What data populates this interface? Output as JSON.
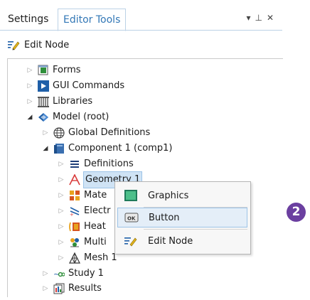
{
  "tabs": {
    "settings": "Settings",
    "editor_tools": "Editor Tools"
  },
  "window_controls": {
    "dropdown": "▾",
    "pin": "⊥",
    "close": "✕"
  },
  "toolbar": {
    "edit_node": "Edit Node"
  },
  "tree": {
    "forms": "Forms",
    "gui_commands": "GUI Commands",
    "libraries": "Libraries",
    "model_root": "Model (root)",
    "global_definitions": "Global Definitions",
    "component1": "Component 1 (comp1)",
    "definitions": "Definitions",
    "geometry1": "Geometry 1",
    "materials": "Mate",
    "electric": "Electr",
    "heat": "Heat",
    "multiphysics": "Multi",
    "mesh1": "Mesh 1",
    "study1": "Study 1",
    "results": "Results"
  },
  "context_menu": {
    "graphics": "Graphics",
    "button": "Button",
    "edit_node": "Edit Node"
  },
  "callout_badge": "2",
  "colors": {
    "accent": "#3277b6",
    "badge": "#6b3fa0",
    "highlight": "#e4eef8"
  }
}
